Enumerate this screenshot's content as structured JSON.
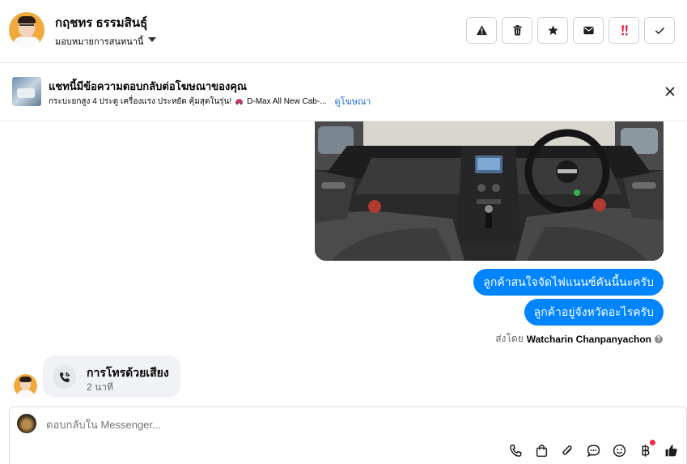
{
  "header": {
    "contact_name": "กฤชทร ธรรมสินธุ์",
    "assign_label": "มอบหมายการสนทนานี้",
    "actions": [
      {
        "name": "spam-button",
        "icon": "warning-icon"
      },
      {
        "name": "delete-button",
        "icon": "trash-icon"
      },
      {
        "name": "star-button",
        "icon": "star-icon"
      },
      {
        "name": "mark-unread-button",
        "icon": "envelope-icon"
      },
      {
        "name": "follow-up-button",
        "icon": "exclamation-icon"
      },
      {
        "name": "done-button",
        "icon": "check-icon"
      }
    ],
    "follow_up_color": "#e41e3f"
  },
  "ad_banner": {
    "title": "แชทนี้มีข้อความตอบกลับต่อโฆษณาของคุณ",
    "subtitle": "กระบะยกสูง 4 ประตู เครื่องแรง ประหยัด คุ้มสุดในรุ่น!",
    "ad_name": "D-Max All New Cab-...",
    "link_label": "ดูโฆษณา"
  },
  "messages": {
    "outgoing": [
      "ลูกค้าสนใจจัดไฟแนนซ์คันนี้นะครับ",
      "ลูกค้าอยู่จังหวัดอะไรครับ"
    ],
    "sent_by_prefix": "ส่งโดย",
    "sent_by_name": "Watcharin Chanpanyachon",
    "bubble_color": "#0084ff"
  },
  "call": {
    "title": "การโทรด้วยเสียง",
    "duration": "2 นาที"
  },
  "composer": {
    "placeholder": "ตอบกลับใน Messenger...",
    "tools": [
      "phone-icon",
      "shopping-bag-icon",
      "paperclip-icon",
      "speech-bubble-icon",
      "emoji-icon",
      "baht-icon",
      "thumbs-up-icon"
    ]
  }
}
